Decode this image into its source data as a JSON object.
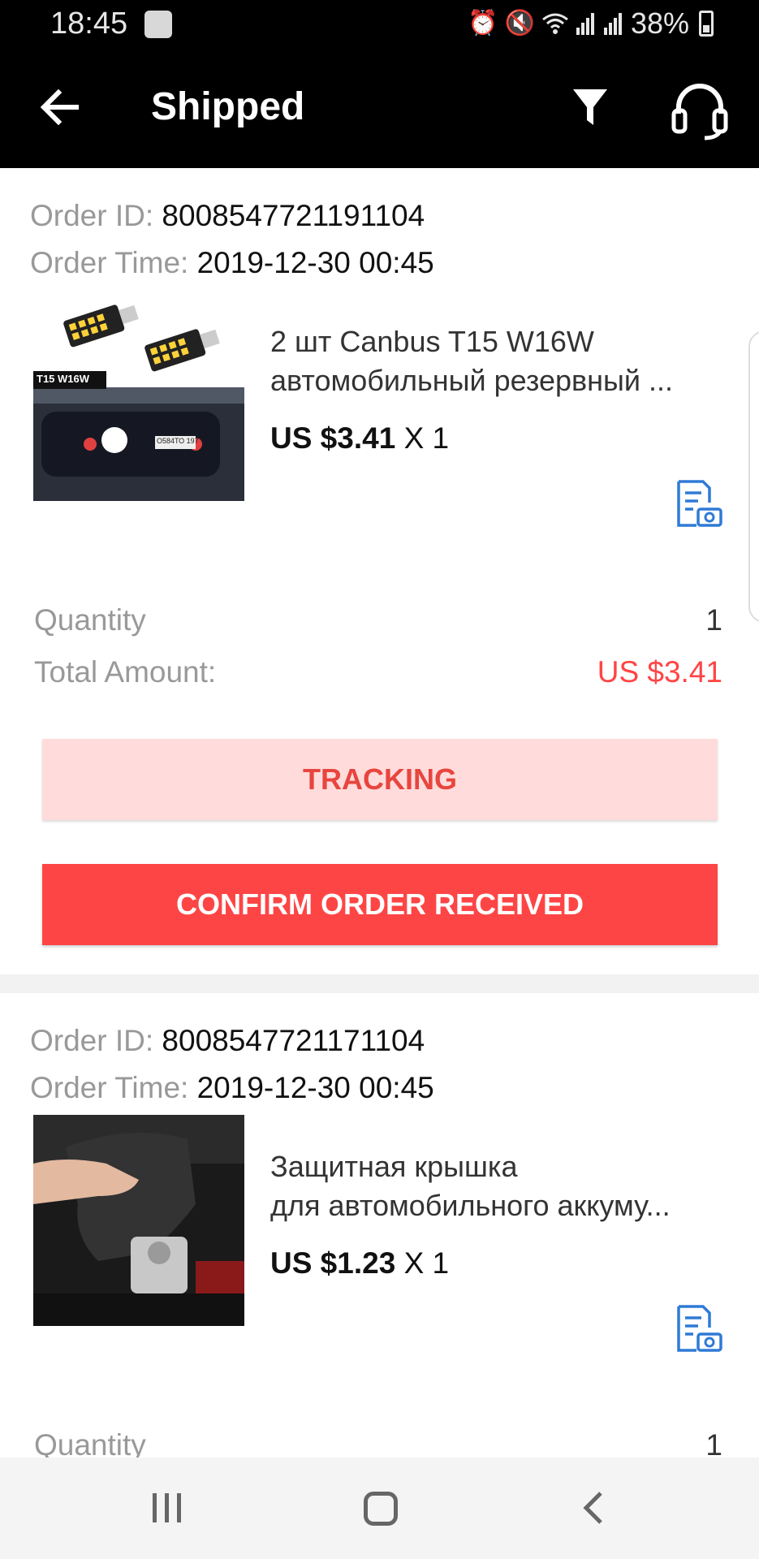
{
  "status_bar": {
    "time": "18:45",
    "battery": "38%",
    "icons": [
      "app-notification-icon",
      "alarm-icon",
      "mute-icon",
      "wifi-icon",
      "signal-icon",
      "signal-icon",
      "battery-icon"
    ]
  },
  "app_bar": {
    "title": "Shipped",
    "icons": [
      "back-arrow-icon",
      "filter-icon",
      "headset-icon"
    ]
  },
  "orders": [
    {
      "order_id_label": "Order ID:",
      "order_id": "8008547721191104",
      "order_time_label": "Order Time:",
      "order_time": "2019-12-30 00:45",
      "thumb_label": "T15 W16W",
      "thumb_plate": "О584ТО 197",
      "product_line1": "2 шт Canbus T15 W16W",
      "product_line2": "автомобильный резервный ...",
      "price": "US $3.41",
      "qty_suffix": "X 1",
      "quantity_label": "Quantity",
      "quantity_value": "1",
      "total_label": "Total Amount:",
      "total_value": "US $3.41",
      "tracking_label": "TRACKING",
      "confirm_label": "CONFIRM ORDER RECEIVED"
    },
    {
      "order_id_label": "Order ID:",
      "order_id": "8008547721171104",
      "order_time_label": "Order Time:",
      "order_time": "2019-12-30 00:45",
      "product_line1": "Защитная крышка",
      "product_line2": "для автомобильного аккуму...",
      "price": "US $1.23",
      "qty_suffix": "X 1",
      "quantity_label": "Quantity",
      "quantity_value": "1"
    }
  ],
  "colors": {
    "accent_red": "#fe4545",
    "tracking_bg": "#ffdcdb",
    "tracking_text": "#e8453f",
    "total_red": "#ff4444",
    "icon_blue": "#2f7ad6"
  }
}
